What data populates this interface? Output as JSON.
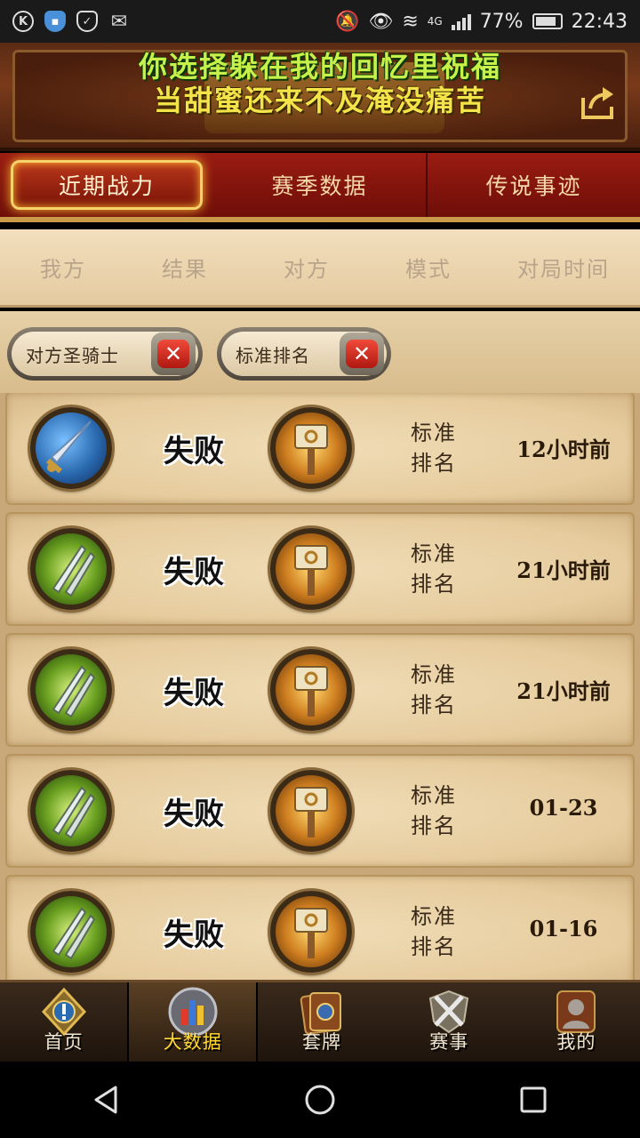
{
  "status_bar": {
    "network": "4G",
    "battery": "77%",
    "time": "22:43"
  },
  "header": {
    "lyric_line1": "你选择躲在我的回忆里祝福",
    "lyric_line2": "当甜蜜还来不及淹没痛苦"
  },
  "tabs": [
    {
      "label": "近期战力",
      "active": true
    },
    {
      "label": "赛季数据",
      "active": false
    },
    {
      "label": "传说事迹",
      "active": false
    }
  ],
  "columns": [
    "我方",
    "结果",
    "对方",
    "模式",
    "对局时间"
  ],
  "filters": [
    {
      "label": "对方圣骑士"
    },
    {
      "label": "标准排名"
    }
  ],
  "matches": [
    {
      "my_class": "mage-icon",
      "result": "失败",
      "opp_class": "paladin-icon",
      "mode_line1": "标准",
      "mode_line2": "排名",
      "time": "12小时前"
    },
    {
      "my_class": "rogue-icon",
      "result": "失败",
      "opp_class": "paladin-icon",
      "mode_line1": "标准",
      "mode_line2": "排名",
      "time": "21小时前"
    },
    {
      "my_class": "rogue-icon",
      "result": "失败",
      "opp_class": "paladin-icon",
      "mode_line1": "标准",
      "mode_line2": "排名",
      "time": "21小时前"
    },
    {
      "my_class": "rogue-icon",
      "result": "失败",
      "opp_class": "paladin-icon",
      "mode_line1": "标准",
      "mode_line2": "排名",
      "time": "01-23"
    },
    {
      "my_class": "rogue-icon",
      "result": "失败",
      "opp_class": "paladin-icon",
      "mode_line1": "标准",
      "mode_line2": "排名",
      "time": "01-16"
    }
  ],
  "bottom_nav": [
    {
      "label": "首页",
      "icon": "home-icon",
      "active": false
    },
    {
      "label": "大数据",
      "icon": "bigdata-icon",
      "active": true
    },
    {
      "label": "套牌",
      "icon": "deck-icon",
      "active": false
    },
    {
      "label": "赛事",
      "icon": "tournament-icon",
      "active": false
    },
    {
      "label": "我的",
      "icon": "profile-icon",
      "active": false
    }
  ],
  "colors": {
    "tab_bg": "#9a1c12",
    "active_tab_border": "#f6d26a",
    "parchment": "#f0dcb6",
    "nav_active_label": "#ffd830"
  }
}
